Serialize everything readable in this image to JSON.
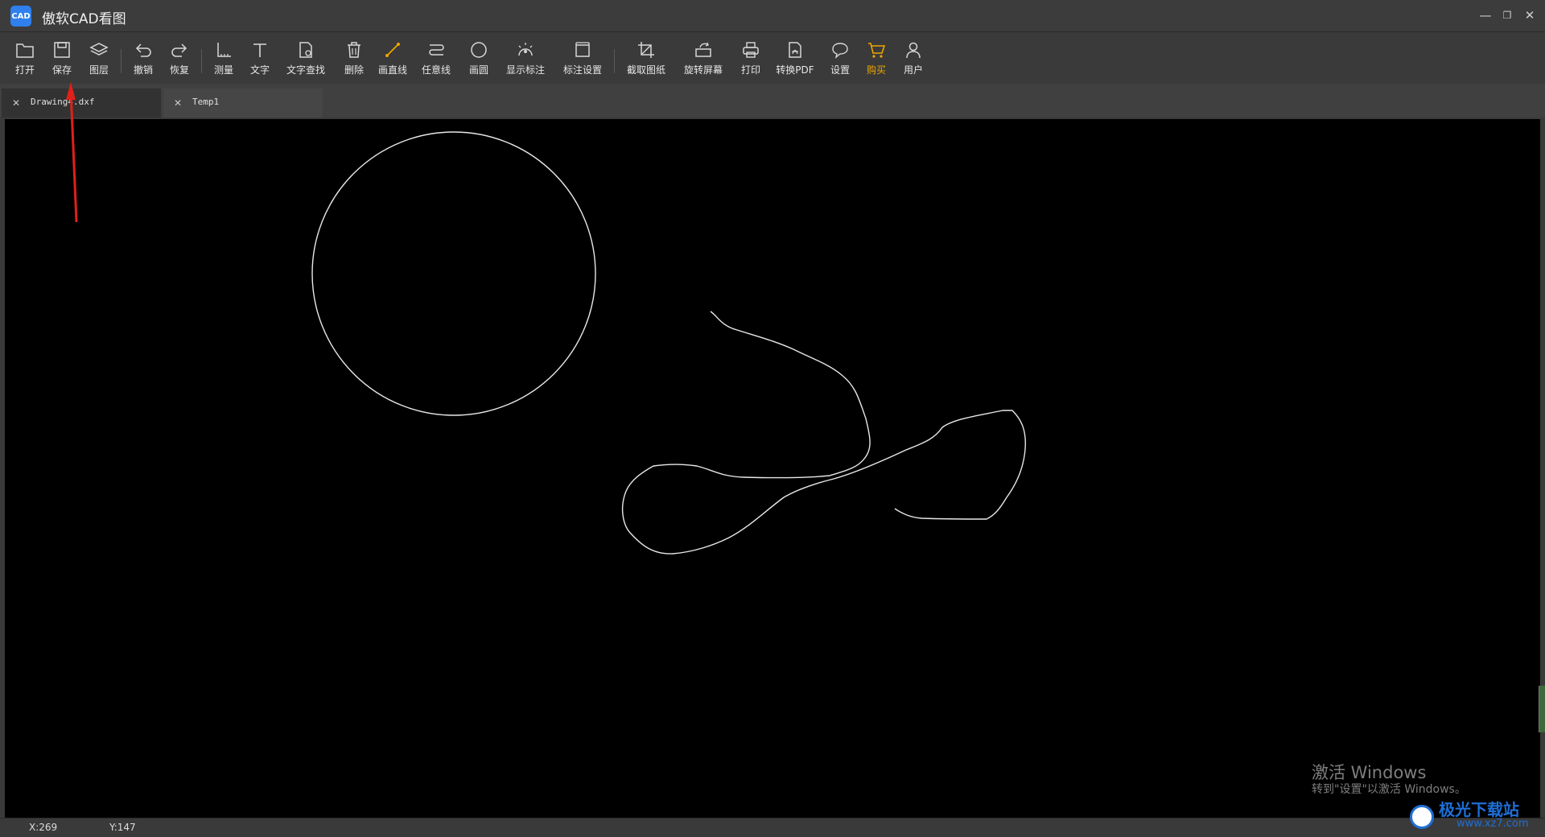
{
  "app": {
    "title": "傲软CAD看图",
    "logo_text": "CAD",
    "accent_color": "#f0a500",
    "brand_color": "#2f80ed"
  },
  "window_controls": {
    "minimize": "—",
    "restore": "❐",
    "close": "✕"
  },
  "toolbar": {
    "items": [
      {
        "label": "打开",
        "icon": "folder-open-icon"
      },
      {
        "label": "保存",
        "icon": "save-icon"
      },
      {
        "label": "图层",
        "icon": "layers-icon"
      },
      {
        "label": "撤销",
        "icon": "undo-icon"
      },
      {
        "label": "恢复",
        "icon": "redo-icon"
      },
      {
        "label": "测量",
        "icon": "measure-icon"
      },
      {
        "label": "文字",
        "icon": "text-icon"
      },
      {
        "label": "文字查找",
        "icon": "text-search-icon"
      },
      {
        "label": "删除",
        "icon": "delete-icon"
      },
      {
        "label": "画直线",
        "icon": "draw-line-icon"
      },
      {
        "label": "任意线",
        "icon": "freehand-line-icon"
      },
      {
        "label": "画圆",
        "icon": "draw-circle-icon"
      },
      {
        "label": "显示标注",
        "icon": "show-annotation-icon"
      },
      {
        "label": "标注设置",
        "icon": "annotation-settings-icon"
      },
      {
        "label": "截取图纸",
        "icon": "crop-drawing-icon"
      },
      {
        "label": "旋转屏幕",
        "icon": "rotate-screen-icon"
      },
      {
        "label": "打印",
        "icon": "print-icon"
      },
      {
        "label": "转换PDF",
        "icon": "convert-pdf-icon"
      },
      {
        "label": "设置",
        "icon": "settings-chat-icon"
      },
      {
        "label": "购买",
        "icon": "cart-icon"
      },
      {
        "label": "用户",
        "icon": "user-icon"
      }
    ]
  },
  "tabs": [
    {
      "name": "Drawing4.dxf",
      "close": "✕",
      "active": true
    },
    {
      "name": "Temp1",
      "close": "✕",
      "active": false
    }
  ],
  "status": {
    "x": "X:269",
    "y": "Y:147"
  },
  "watermark": {
    "title": "激活 Windows",
    "subtitle": "转到\"设置\"以激活 Windows。"
  },
  "site_stamp": {
    "text": "极光下载站",
    "url": "www.xz7.com"
  }
}
